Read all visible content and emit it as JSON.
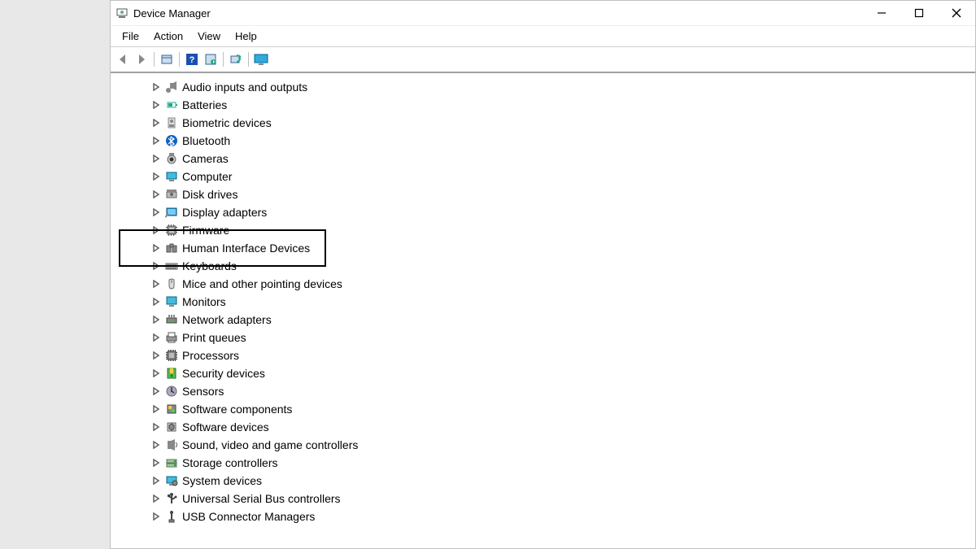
{
  "title": "Device Manager",
  "menu": [
    "File",
    "Action",
    "View",
    "Help"
  ],
  "tree": [
    {
      "id": "audio",
      "label": "Audio inputs and outputs"
    },
    {
      "id": "batteries",
      "label": "Batteries"
    },
    {
      "id": "biometric",
      "label": "Biometric devices"
    },
    {
      "id": "bluetooth",
      "label": "Bluetooth"
    },
    {
      "id": "cameras",
      "label": "Cameras"
    },
    {
      "id": "computer",
      "label": "Computer"
    },
    {
      "id": "diskdrives",
      "label": "Disk drives"
    },
    {
      "id": "display",
      "label": "Display adapters"
    },
    {
      "id": "firmware",
      "label": "Firmware"
    },
    {
      "id": "hid",
      "label": "Human Interface Devices"
    },
    {
      "id": "keyboards",
      "label": "Keyboards"
    },
    {
      "id": "mice",
      "label": "Mice and other pointing devices"
    },
    {
      "id": "monitors",
      "label": "Monitors"
    },
    {
      "id": "network",
      "label": "Network adapters"
    },
    {
      "id": "printqueues",
      "label": "Print queues"
    },
    {
      "id": "processors",
      "label": "Processors"
    },
    {
      "id": "security",
      "label": "Security devices"
    },
    {
      "id": "sensors",
      "label": "Sensors"
    },
    {
      "id": "swcomp",
      "label": "Software components"
    },
    {
      "id": "swdev",
      "label": "Software devices"
    },
    {
      "id": "sound",
      "label": "Sound, video and game controllers"
    },
    {
      "id": "storage",
      "label": "Storage controllers"
    },
    {
      "id": "system",
      "label": "System devices"
    },
    {
      "id": "usb",
      "label": "Universal Serial Bus controllers"
    },
    {
      "id": "usbconn",
      "label": "USB Connector Managers"
    }
  ],
  "highlight_id": "hid"
}
